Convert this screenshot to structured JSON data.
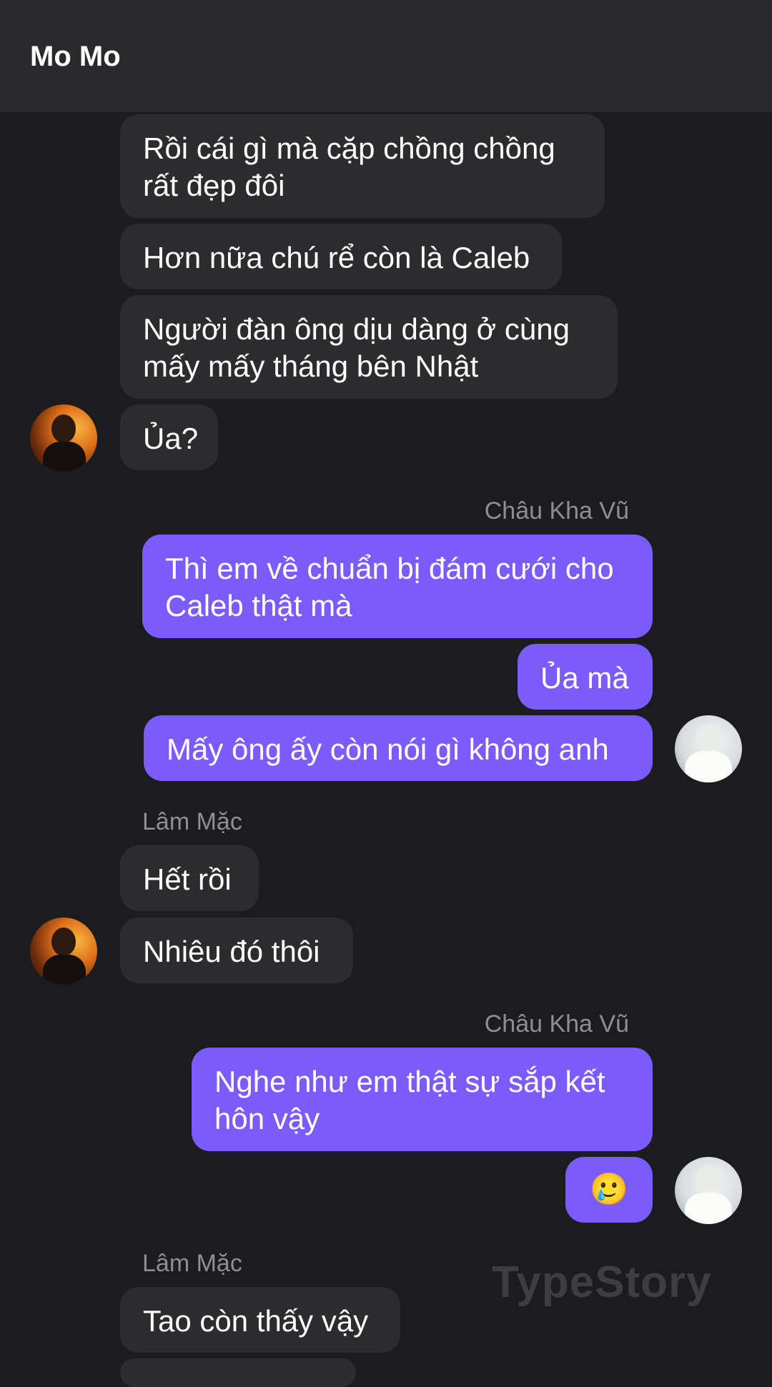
{
  "header": {
    "title": "Mo Mo"
  },
  "messages": {
    "m1": "Rồi cái gì mà cặp chồng chồng rất đẹp đôi",
    "m2": "Hơn nữa chú rể còn là Caleb",
    "m3": "Người đàn ông dịu dàng ở cùng mấy mấy tháng bên Nhật",
    "m4": "Ủa?",
    "sender1": "Châu Kha Vũ",
    "m5": "Thì em về chuẩn bị đám cưới cho Caleb thật mà",
    "m6": "Ủa mà",
    "m7": "Mấy ông ấy còn nói gì không anh",
    "sender2": "Lâm Mặc",
    "m8": "Hết rồi",
    "m9": "Nhiêu đó thôi",
    "sender3": "Châu Kha Vũ",
    "m10": "Nghe như em thật sự sắp kết hôn vậy",
    "m11": "🥲",
    "sender4": "Lâm Mặc",
    "m12": "Tao còn thấy vậy"
  },
  "watermark": "TypeStory",
  "colors": {
    "background": "#1c1c1e",
    "header": "#2a2a2c",
    "incoming_bubble": "#2c2c2e",
    "outgoing_bubble": "#7b5cfa",
    "sender_name": "#8e8e93"
  },
  "avatars": {
    "left": "person-avatar-fire-background",
    "right": "person-avatar-white-background"
  }
}
